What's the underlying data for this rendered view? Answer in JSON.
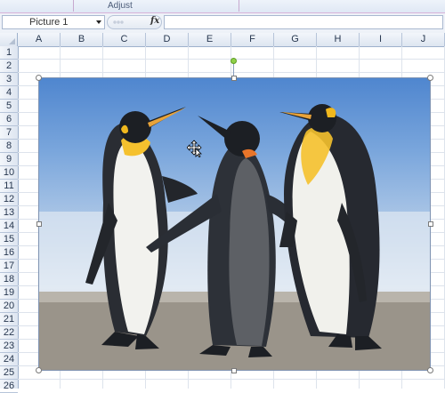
{
  "ribbon": {
    "group_label": "Adjust"
  },
  "formula_bar": {
    "name_box": "Picture 1",
    "fx_label": "fx",
    "formula": ""
  },
  "columns": [
    "A",
    "B",
    "C",
    "D",
    "E",
    "F",
    "G",
    "H",
    "I",
    "J"
  ],
  "rows": [
    "1",
    "2",
    "3",
    "4",
    "5",
    "6",
    "7",
    "8",
    "9",
    "10",
    "11",
    "12",
    "13",
    "14",
    "15",
    "16",
    "17",
    "18",
    "19",
    "20",
    "21",
    "22",
    "23",
    "24",
    "25",
    "26"
  ],
  "picture": {
    "name": "Picture 1",
    "subject": "penguins-image"
  }
}
